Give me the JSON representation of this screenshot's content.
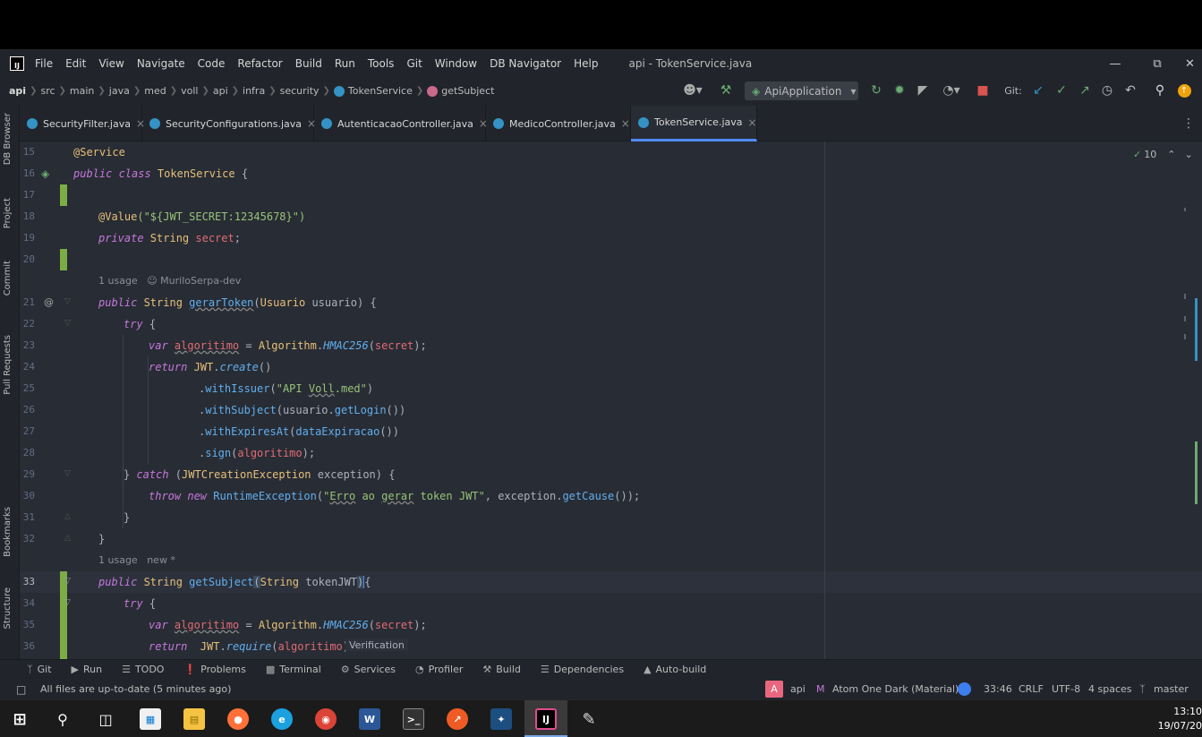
{
  "app": {
    "title": "api - TokenService.java",
    "logo": "IJ"
  },
  "menu": [
    "File",
    "Edit",
    "View",
    "Navigate",
    "Code",
    "Refactor",
    "Build",
    "Run",
    "Tools",
    "Git",
    "Window",
    "DB Navigator",
    "Help"
  ],
  "breadcrumb": [
    "api",
    "src",
    "main",
    "java",
    "med",
    "voll",
    "api",
    "infra",
    "security",
    "TokenService",
    "getSubject"
  ],
  "run_config": "ApiApplication",
  "git_label": "Git:",
  "tabs": [
    {
      "label": "SecurityFilter.java"
    },
    {
      "label": "SecurityConfigurations.java"
    },
    {
      "label": "AutenticacaoController.java"
    },
    {
      "label": "MedicoController.java"
    },
    {
      "label": "TokenService.java",
      "active": true
    }
  ],
  "left_tools": [
    "DB Browser",
    "Project",
    "Commit",
    "Pull Requests",
    "Bookmarks",
    "Structure"
  ],
  "inspection_count": "10",
  "hints": {
    "h1": "1 usage",
    "h1b": "MuriloSerpa-dev",
    "h2": "1 usage",
    "h2b": "new *"
  },
  "inlay_hint": "Verification",
  "line_numbers": [
    "15",
    "16",
    "17",
    "18",
    "19",
    "20",
    "21",
    "22",
    "23",
    "24",
    "25",
    "26",
    "27",
    "28",
    "29",
    "30",
    "31",
    "32",
    "33",
    "34",
    "35",
    "36"
  ],
  "code": {
    "l15": "@Service",
    "l16a": "public class ",
    "l16b": "TokenService",
    "l16c": " {",
    "l18a": "@Value",
    "l18b": "(\"${JWT_SECRET:12345678}\")",
    "l19a": "private ",
    "l19b": "String ",
    "l19c": "secret",
    "l19d": ";",
    "l21a": "public ",
    "l21b": "String ",
    "l21c": "gerarToken",
    "l21d": "(",
    "l21e": "Usuario",
    "l21f": " usuario) {",
    "l22a": "try",
    "l22b": " {",
    "l23a": "var ",
    "l23b": "algoritimo",
    "l23c": " = ",
    "l23d": "Algorithm",
    "l23e": ".",
    "l23f": "HMAC256",
    "l23g": "(",
    "l23h": "secret",
    "l23i": ");",
    "l24a": "return ",
    "l24b": "JWT",
    "l24c": ".",
    "l24d": "create",
    "l24e": "()",
    "l25a": ".",
    "l25b": "withIssuer",
    "l25c": "(",
    "l25d": "\"API ",
    "l25e": "Voll",
    "l25f": ".med\"",
    "l25g": ")",
    "l26a": ".",
    "l26b": "withSubject",
    "l26c": "(usuario.",
    "l26d": "getLogin",
    "l26e": "())",
    "l27a": ".",
    "l27b": "withExpiresAt",
    "l27c": "(",
    "l27d": "dataExpiracao",
    "l27e": "())",
    "l28a": ".",
    "l28b": "sign",
    "l28c": "(",
    "l28d": "algoritimo",
    "l28e": ");",
    "l29a": "} ",
    "l29b": "catch",
    "l29c": " (",
    "l29d": "JWTCreationException",
    "l29e": " exception) {",
    "l30a": "throw ",
    "l30b": "new ",
    "l30c": "RuntimeException",
    "l30d": "(",
    "l30e": "\"",
    "l30f": "Erro",
    "l30g": " ao ",
    "l30h": "gerar",
    "l30i": " token JWT\"",
    "l30j": ", exception.",
    "l30k": "getCause",
    "l30l": "());",
    "l31": "}",
    "l32": "}",
    "l33a": "public ",
    "l33b": "String ",
    "l33c": "getSubject",
    "l33d": "(",
    "l33e": "String",
    "l33f": " tokenJWT",
    "l33g": ")",
    "l33h": "{",
    "l34a": "try",
    "l34b": " {",
    "l35a": "var ",
    "l35b": "algoritimo",
    "l35c": " = ",
    "l35d": "Algorithm",
    "l35e": ".",
    "l35f": "HMAC256",
    "l35g": "(",
    "l35h": "secret",
    "l35i": ");",
    "l36a": "return ",
    "l36b": " JWT",
    "l36c": ".",
    "l36d": "require",
    "l36e": "(",
    "l36f": "algoritimo",
    "l36g": ")"
  },
  "bottom_tools": [
    "Git",
    "Run",
    "TODO",
    "Problems",
    "Terminal",
    "Services",
    "Profiler",
    "Build",
    "Dependencies",
    "Auto-build"
  ],
  "status": {
    "message": "All files are up-to-date (5 minutes ago)",
    "project_badge": "A",
    "project": "api",
    "theme": "Atom One Dark (Material)",
    "position": "33:46",
    "line_sep": "CRLF",
    "encoding": "UTF-8",
    "indent": "4 spaces",
    "branch": "master"
  },
  "taskbar": {
    "time": "13:10",
    "date": "19/07/20"
  },
  "colors": {
    "background": "#282c34",
    "chrome": "#21252b",
    "keyword": "#c678dd",
    "type": "#e5c07b",
    "function": "#61afef",
    "string": "#98c379",
    "field": "#e06c75",
    "accent": "#528bff"
  }
}
